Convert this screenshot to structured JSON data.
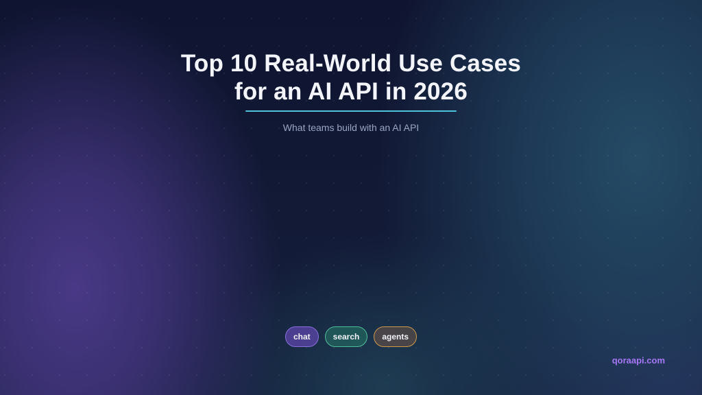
{
  "slide": {
    "title_line_1": "Top 10 Real-World Use Cases",
    "title_line_2": "for an AI API in 2026",
    "subtitle": "What teams build with an AI API"
  },
  "tags": [
    {
      "label": "chat",
      "color": "#8b6fe0"
    },
    {
      "label": "search",
      "color": "#4fbf9a"
    },
    {
      "label": "agents",
      "color": "#d09a4e"
    }
  ],
  "footer": {
    "brand": "qoraapi.com",
    "brand_color": "#a678f5"
  },
  "theme": {
    "accent_underline": "#4fc3dc",
    "background": "#10162e"
  }
}
